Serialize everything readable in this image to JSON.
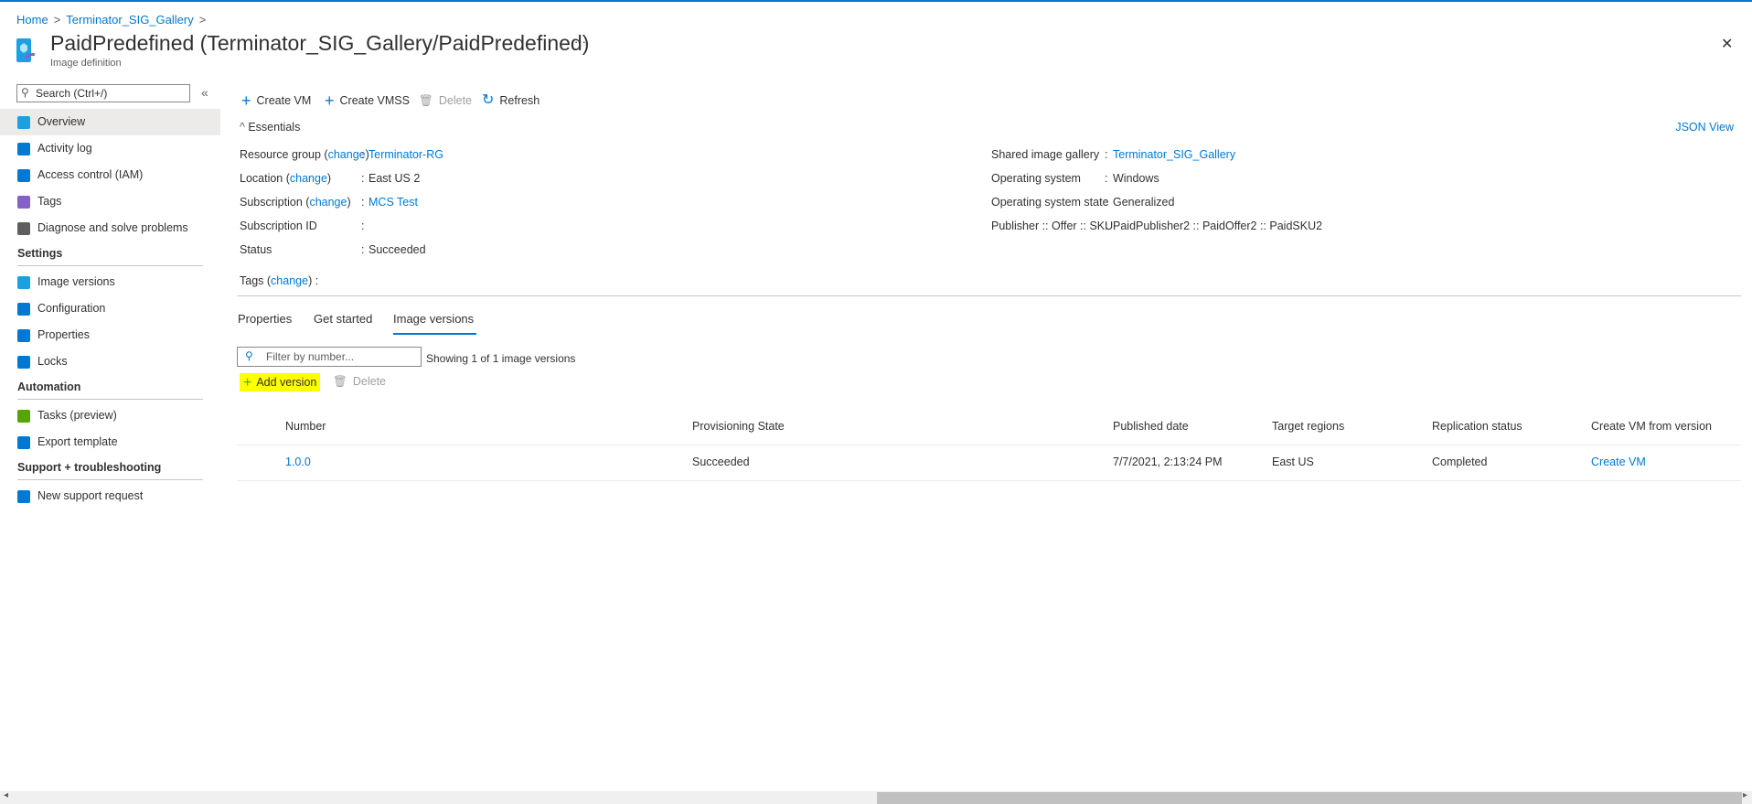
{
  "breadcrumb": [
    {
      "label": "Home"
    },
    {
      "label": "Terminator_SIG_Gallery"
    }
  ],
  "header": {
    "title": "PaidPredefined (Terminator_SIG_Gallery/PaidPredefined)",
    "subtitle": "Image definition",
    "more": "···",
    "close": "✕"
  },
  "sidebar": {
    "search_placeholder": "Search (Ctrl+/)",
    "collapse": "«",
    "items": [
      {
        "label": "Overview",
        "color": "#1ba1e2"
      },
      {
        "label": "Activity log",
        "color": "#0078d4"
      },
      {
        "label": "Access control (IAM)",
        "color": "#0078d4"
      },
      {
        "label": "Tags",
        "color": "#8661c5"
      },
      {
        "label": "Diagnose and solve problems",
        "color": "#605e5c"
      }
    ],
    "sections": [
      {
        "title": "Settings",
        "items": [
          {
            "label": "Image versions",
            "color": "#1ba1e2"
          },
          {
            "label": "Configuration",
            "color": "#0078d4"
          },
          {
            "label": "Properties",
            "color": "#0078d4"
          },
          {
            "label": "Locks",
            "color": "#0078d4"
          }
        ]
      },
      {
        "title": "Automation",
        "items": [
          {
            "label": "Tasks (preview)",
            "color": "#57a300"
          },
          {
            "label": "Export template",
            "color": "#0078d4"
          }
        ]
      },
      {
        "title": "Support + troubleshooting",
        "items": [
          {
            "label": "New support request",
            "color": "#0078d4"
          }
        ]
      }
    ]
  },
  "toolbar": {
    "create_vm": "Create VM",
    "create_vmss": "Create VMSS",
    "delete": "Delete",
    "refresh": "Refresh"
  },
  "essentials": {
    "title": "Essentials",
    "json_view": "JSON View",
    "change": "change",
    "left": [
      {
        "label": "Resource group",
        "change": true,
        "value": "Terminator-RG",
        "link": true
      },
      {
        "label": "Location",
        "change": true,
        "value": "East US 2"
      },
      {
        "label": "Subscription",
        "change": true,
        "value": "MCS Test",
        "link": true
      },
      {
        "label": "Subscription ID",
        "value": ""
      },
      {
        "label": "Status",
        "value": "Succeeded"
      }
    ],
    "right": [
      {
        "label": "Shared image gallery",
        "value": "Terminator_SIG_Gallery",
        "link": true
      },
      {
        "label": "Operating system",
        "value": "Windows"
      },
      {
        "label": "Operating system state",
        "value": "Generalized"
      },
      {
        "label": "Publisher :: Offer :: SKU",
        "value": "PaidPublisher2 :: PaidOffer2 :: PaidSKU2"
      }
    ],
    "tags_label": "Tags"
  },
  "tabs": [
    {
      "label": "Properties"
    },
    {
      "label": "Get started"
    },
    {
      "label": "Image versions",
      "active": true
    }
  ],
  "versions": {
    "filter_placeholder": "Filter by number...",
    "showing": "Showing 1 of 1 image versions",
    "add_version": "Add version",
    "delete": "Delete",
    "columns": [
      "Number",
      "Provisioning State",
      "Published date",
      "Target regions",
      "Replication status",
      "Create VM from version"
    ],
    "rows": [
      [
        "1.0.0",
        "Succeeded",
        "7/7/2021, 2:13:24 PM",
        "East US",
        "Completed",
        "Create VM"
      ]
    ]
  }
}
